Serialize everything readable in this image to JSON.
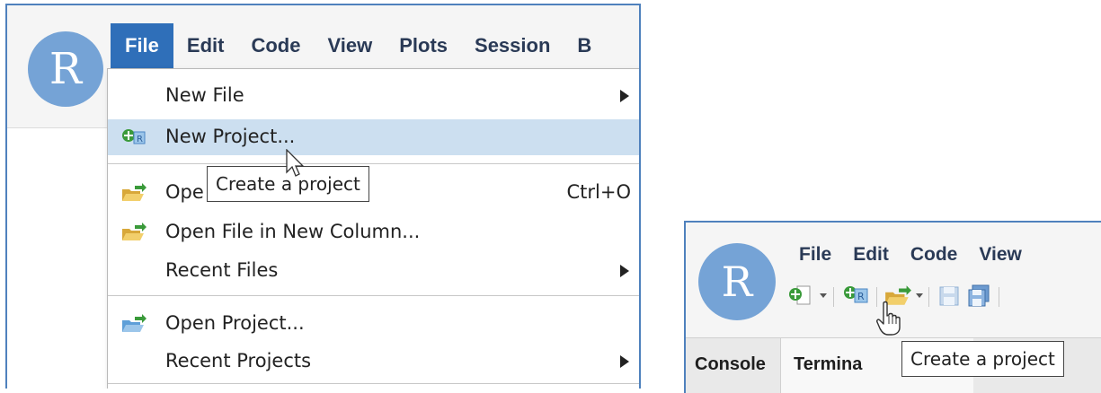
{
  "left_panel": {
    "logo_letter": "R",
    "menubar": [
      "File",
      "Edit",
      "Code",
      "View",
      "Plots",
      "Session",
      "B"
    ],
    "file_menu": [
      {
        "label": "New File",
        "shortcut": "",
        "submenu": true,
        "icon": "none"
      },
      {
        "label": "New Project...",
        "shortcut": "",
        "submenu": false,
        "icon": "new-project-icon",
        "highlighted": true
      },
      {
        "label": "Ope",
        "shortcut": "Ctrl+O",
        "submenu": false,
        "icon": "open-folder-icon"
      },
      {
        "label": "Open File in New Column...",
        "shortcut": "",
        "submenu": false,
        "icon": "open-folder-icon"
      },
      {
        "label": "Recent Files",
        "shortcut": "",
        "submenu": true,
        "icon": "none"
      },
      {
        "label": "Open Project...",
        "shortcut": "",
        "submenu": false,
        "icon": "open-project-icon"
      },
      {
        "label": "Recent Projects",
        "shortcut": "",
        "submenu": true,
        "icon": "none"
      }
    ],
    "tooltip": "Create a project"
  },
  "right_panel": {
    "logo_letter": "R",
    "menubar": [
      "File",
      "Edit",
      "Code",
      "View"
    ],
    "toolbar_icons": [
      "new-file-icon",
      "dropdown-arrow-icon",
      "new-project-icon",
      "open-folder-icon",
      "dropdown-arrow-icon",
      "save-icon",
      "save-all-icon"
    ],
    "tabs": [
      "Console",
      "Termina"
    ],
    "tooltip": "Create a project"
  },
  "colors": {
    "menu_active_bg": "#2f6fb9",
    "highlight_bg": "#ccdff0",
    "logo_bg": "#75a3d6",
    "frame_border": "#4f81bd"
  }
}
